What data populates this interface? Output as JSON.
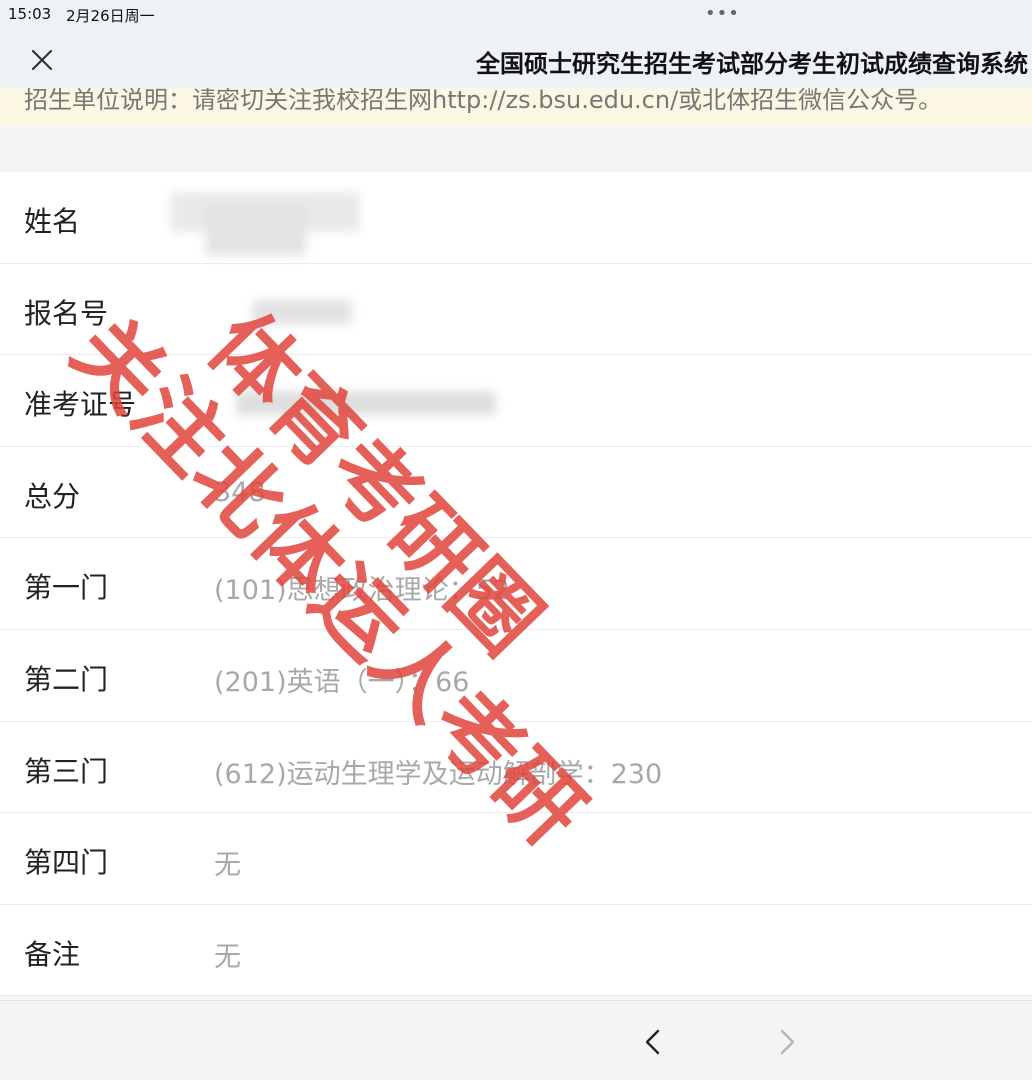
{
  "status_bar": {
    "time": "15:03",
    "date": "2月26日周一",
    "dots": "•••"
  },
  "nav": {
    "title": "全国硕士研究生招生考试部分考生初试成绩查询系统",
    "close_icon": "close-icon"
  },
  "notice": {
    "text": "招生单位说明：请密切关注我校招生网http://zs.bsu.edu.cn/或北体招生微信公众号。"
  },
  "info": {
    "name_label": "姓名",
    "reg_label": "报名号",
    "ticket_label": "准考证号",
    "total_label": "总分",
    "total_value": "348",
    "subject1_label": "第一门",
    "subject1_value": "(101)思想政治理论：52",
    "subject2_label": "第二门",
    "subject2_value": "(201)英语（一）：66",
    "subject3_label": "第三门",
    "subject3_value": "(612)运动生理学及运动解剖学：230",
    "subject4_label": "第四门",
    "subject4_value": "无",
    "remark_label": "备注",
    "remark_value": "无"
  },
  "watermark": {
    "line1": "体育考研圈",
    "line2": "关注北体运人考研"
  },
  "toolbar": {
    "back_icon": "chevron-left-icon",
    "forward_icon": "chevron-right-icon"
  },
  "colors": {
    "watermark": "#e0453c",
    "notice_bg": "#fbf7e3",
    "value_text": "#a8a8a8"
  }
}
